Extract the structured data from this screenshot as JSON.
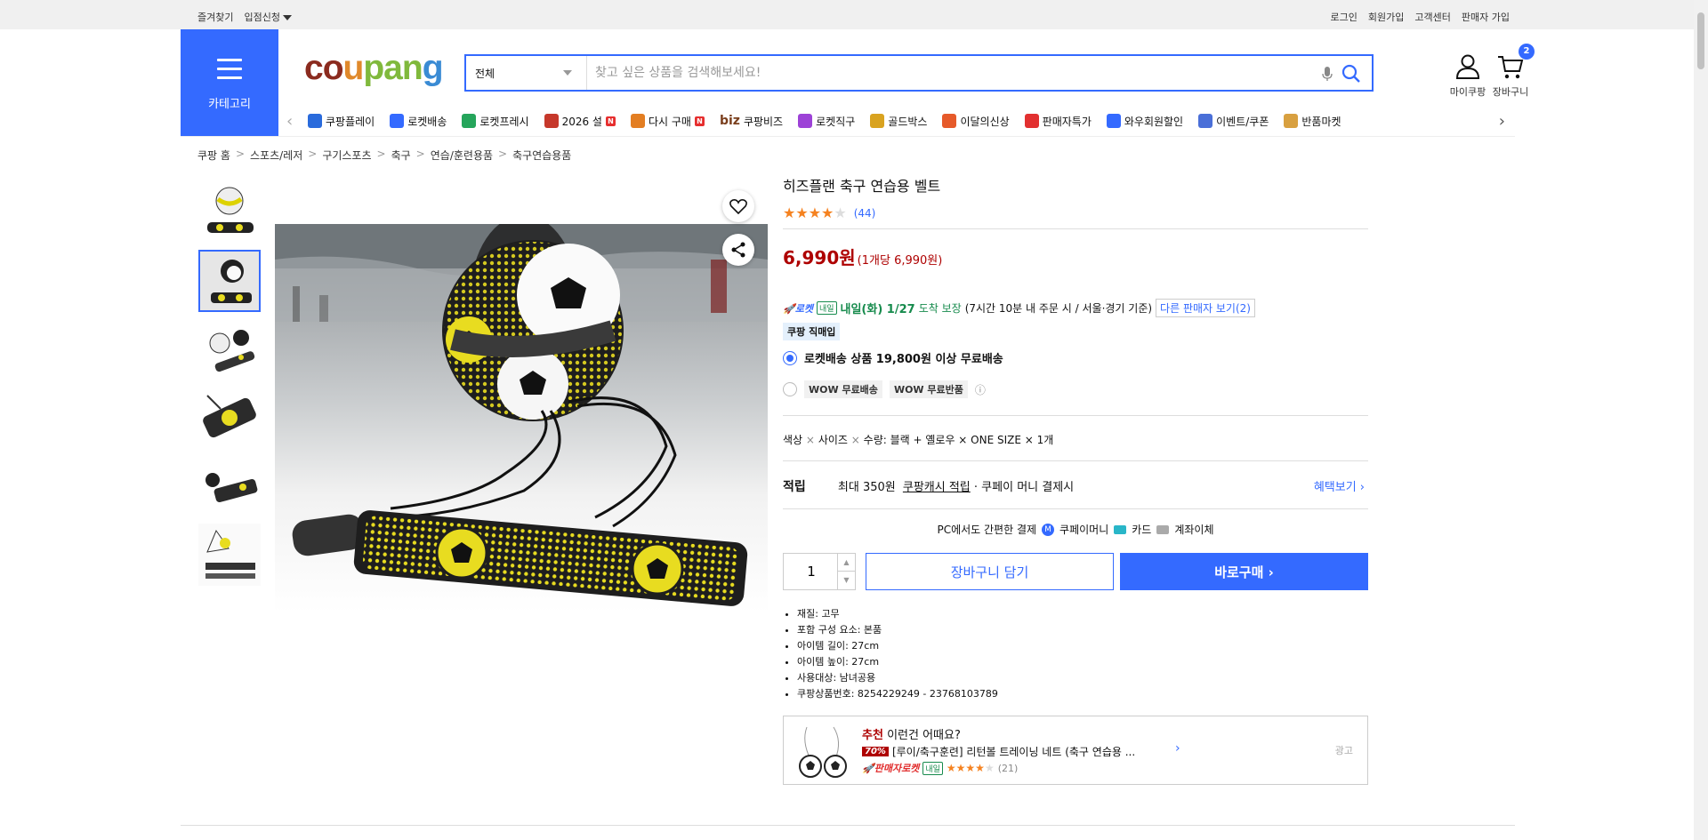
{
  "topbar": {
    "left": [
      "즐겨찾기",
      "입점신청"
    ],
    "right": [
      "로그인",
      "회원가입",
      "고객센터",
      "판매자 가입"
    ]
  },
  "category_button": "카테고리",
  "logo": {
    "parts": [
      "co",
      "u",
      "pan",
      "g"
    ]
  },
  "search": {
    "category": "전체",
    "placeholder": "찾고 싶은 상품을 검색해보세요!",
    "value": ""
  },
  "header_icons": {
    "my": "마이쿠팡",
    "cart": "장바구니",
    "cart_count": "2"
  },
  "nav_items": [
    {
      "label": "쿠팡플레이",
      "color": "#2a6bdc",
      "badge": ""
    },
    {
      "label": "로켓배송",
      "color": "#346aff",
      "badge": ""
    },
    {
      "label": "로켓프레시",
      "color": "#25a55b",
      "badge": ""
    },
    {
      "label": "2026 설",
      "color": "#c6382b",
      "badge": "N"
    },
    {
      "label": "다시 구매",
      "color": "#e37e22",
      "badge": "N"
    },
    {
      "label": "쿠팡비즈",
      "color": "#7a3f1d",
      "badge": "",
      "prefix": "biz"
    },
    {
      "label": "로켓직구",
      "color": "#9d42d7",
      "badge": ""
    },
    {
      "label": "골드박스",
      "color": "#d9a320",
      "badge": ""
    },
    {
      "label": "이달의신상",
      "color": "#e65a2a",
      "badge": ""
    },
    {
      "label": "판매자특가",
      "color": "#e23030",
      "badge": ""
    },
    {
      "label": "와우회원할인",
      "color": "#346aff",
      "badge": ""
    },
    {
      "label": "이벤트/쿠폰",
      "color": "#4a6fd8",
      "badge": ""
    },
    {
      "label": "반품마켓",
      "color": "#d8a040",
      "badge": ""
    }
  ],
  "breadcrumb": [
    "쿠팡 홈",
    "스포츠/레저",
    "구기스포츠",
    "축구",
    "연습/훈련용품",
    "축구연습용품"
  ],
  "product": {
    "title": "히즈플랜 축구 연습용 벨트",
    "rating_stars": 4,
    "review_count": "(44)",
    "price": "6,990원",
    "unit_price": "(1개당 6,990원)",
    "delivery": {
      "rocket": "로켓",
      "naeil": "내일",
      "date": "내일(화) 1/27",
      "guarantee": "도착 보장",
      "condition": "(7시간 10분 내 주문 시 / 서울·경기 기준)",
      "other_sellers": "다른 판매자 보기(2)"
    },
    "direct_tag": "쿠팡 직매입",
    "shipping_option_1": "로켓배송 상품 19,800원 이상 무료배송",
    "wow_tags": [
      "WOW 무료배송",
      "WOW 무료반품"
    ],
    "option": {
      "label_color": "색상",
      "label_size": "사이즈",
      "label_qty": "수량",
      "value": "블랙 + 옐로우 × ONE SIZE × 1개"
    },
    "earn": {
      "label": "적립",
      "text1": "최대 350원",
      "link": "쿠팡캐시 적립",
      "text2": "· 쿠페이 머니 결제시",
      "more": "혜택보기 ›"
    },
    "pay": {
      "label": "PC에서도 간편한 결제",
      "methods": [
        "쿠페이머니",
        "카드",
        "계좌이체"
      ]
    },
    "quantity": "1",
    "cart_button": "장바구니 담기",
    "buy_button": "바로구매 ›",
    "specs": [
      "재질: 고무",
      "포함 구성 요소: 본품",
      "아이템 길이: 27cm",
      "아이템 높이: 27cm",
      "사용대상: 남녀공용",
      "쿠팡상품번호: 8254229249 - 23768103789"
    ]
  },
  "recommend": {
    "head_bold": "추천",
    "head_rest": "이런건 어때요?",
    "discount": "70%",
    "name": "[루이/축구훈련] 리턴볼 트레이닝 네트 (축구 연습용 ...",
    "seller_rocket": "판매자로켓",
    "naeil": "내일",
    "reviews": "(21)",
    "ad": "광고"
  },
  "colors": {
    "accent": "#346aff",
    "price": "#ae0000",
    "green": "#178b4d",
    "star": "#f58220"
  }
}
